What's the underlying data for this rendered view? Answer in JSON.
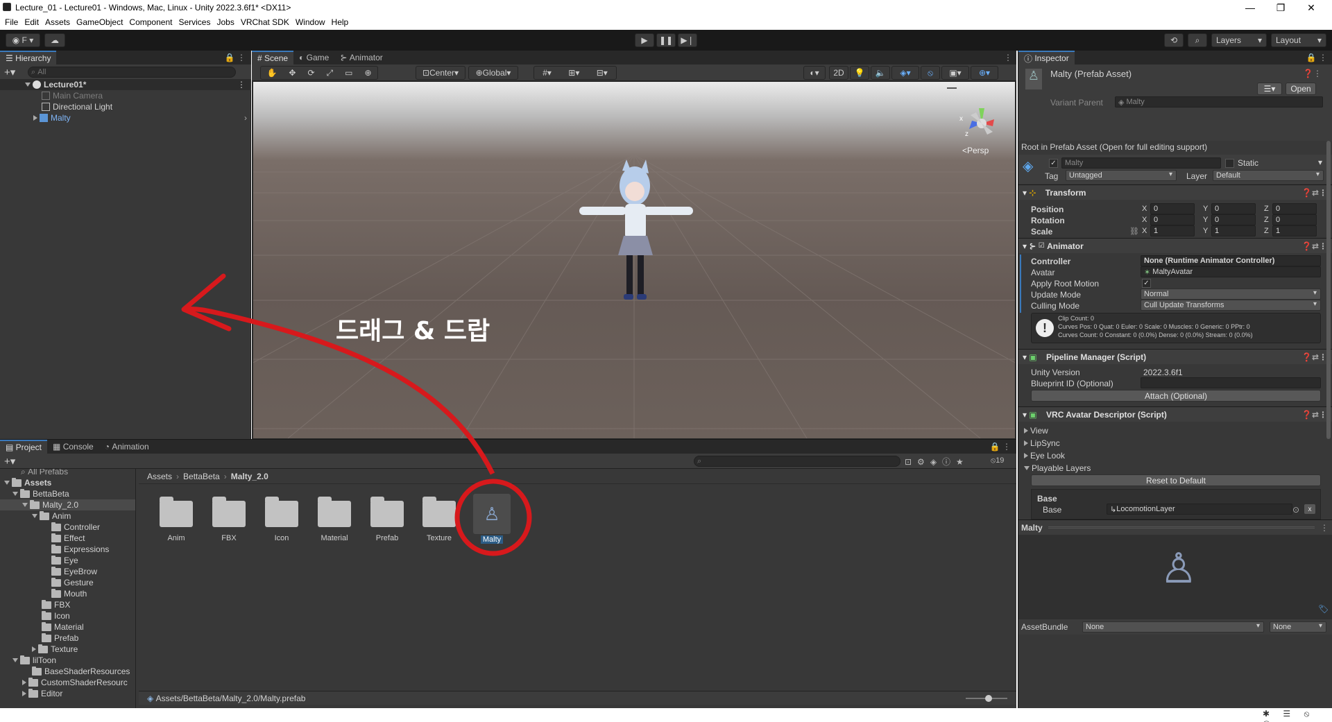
{
  "window": {
    "title": "Lecture_01 - Lecture01 - Windows, Mac, Linux - Unity 2022.3.6f1* <DX11>",
    "min": "—",
    "max": "❐",
    "close": "✕"
  },
  "menu": [
    "File",
    "Edit",
    "Assets",
    "GameObject",
    "Component",
    "Services",
    "Jobs",
    "VRChat SDK",
    "Window",
    "Help"
  ],
  "toolbar": {
    "account": "F",
    "layers": "Layers",
    "layout": "Layout"
  },
  "hierarchy": {
    "tab": "Hierarchy",
    "search_placeholder": "All",
    "scene": "Lecture01*",
    "items": [
      "Main Camera",
      "Directional Light",
      "Malty"
    ]
  },
  "scene": {
    "tabs": [
      "Scene",
      "Game",
      "Animator"
    ],
    "pivot": "Center",
    "space": "Global",
    "mode2d": "2D",
    "persp": "<Persp"
  },
  "annotation": {
    "text": "드래그 & 드랍",
    "color": "#d7191c"
  },
  "project": {
    "tabs": [
      "Project",
      "Console",
      "Animation"
    ],
    "visible_count": "19",
    "breadcrumb": [
      "Assets",
      "BettaBeta",
      "Malty_2.0"
    ],
    "tree": [
      "All Prefabs",
      "Assets",
      "BettaBeta",
      "Malty_2.0",
      "Anim",
      "Controller",
      "Effect",
      "Expressions",
      "Eye",
      "EyeBrow",
      "Gesture",
      "Mouth",
      "FBX",
      "Icon",
      "Material",
      "Prefab",
      "Texture",
      "lilToon",
      "BaseShaderResources",
      "CustomShaderResourc",
      "Editor"
    ],
    "assets": [
      "Anim",
      "FBX",
      "Icon",
      "Material",
      "Prefab",
      "Texture",
      "Malty"
    ],
    "path": "Assets/BettaBeta/Malty_2.0/Malty.prefab"
  },
  "inspector": {
    "tab": "Inspector",
    "object": "Malty (Prefab Asset)",
    "open": "Open",
    "variant_label": "Variant Parent",
    "variant_value": "Malty",
    "root_note": "Root in Prefab Asset (Open for full editing support)",
    "name": "Malty",
    "static": "Static",
    "tag_label": "Tag",
    "tag": "Untagged",
    "layer_label": "Layer",
    "layer": "Default",
    "transform": {
      "title": "Transform",
      "position": "Position",
      "rotation": "Rotation",
      "scale": "Scale",
      "x": "X",
      "y": "Y",
      "z": "Z",
      "pos": [
        "0",
        "0",
        "0"
      ],
      "rot": [
        "0",
        "0",
        "0"
      ],
      "scl": [
        "1",
        "1",
        "1"
      ]
    },
    "animator": {
      "title": "Animator",
      "controller_label": "Controller",
      "controller": "None (Runtime Animator Controller)",
      "avatar_label": "Avatar",
      "avatar": "MaltyAvatar",
      "root_motion": "Apply Root Motion",
      "update_label": "Update Mode",
      "update": "Normal",
      "culling_label": "Culling Mode",
      "culling": "Cull Update Transforms",
      "info1": "Clip Count: 0",
      "info2": "Curves Pos: 0 Quat: 0 Euler: 0 Scale: 0 Muscles: 0 Generic: 0 PPtr: 0",
      "info3": "Curves Count: 0 Constant: 0 (0.0%) Dense: 0 (0.0%) Stream: 0 (0.0%)"
    },
    "pipeline": {
      "title": "Pipeline Manager (Script)",
      "unity_label": "Unity Version",
      "unity": "2022.3.6f1",
      "blueprint_label": "Blueprint ID (Optional)",
      "attach": "Attach (Optional)"
    },
    "vrc": {
      "title": "VRC Avatar Descriptor (Script)",
      "view": "View",
      "lipsync": "LipSync",
      "eyelook": "Eye Look",
      "playable": "Playable Layers",
      "reset": "Reset to Default",
      "base_header": "Base",
      "base_label": "Base",
      "base_value": "LocomotionLayer"
    },
    "preview": "Malty",
    "assetbundle_label": "AssetBundle",
    "assetbundle": "None",
    "variant": "None"
  }
}
